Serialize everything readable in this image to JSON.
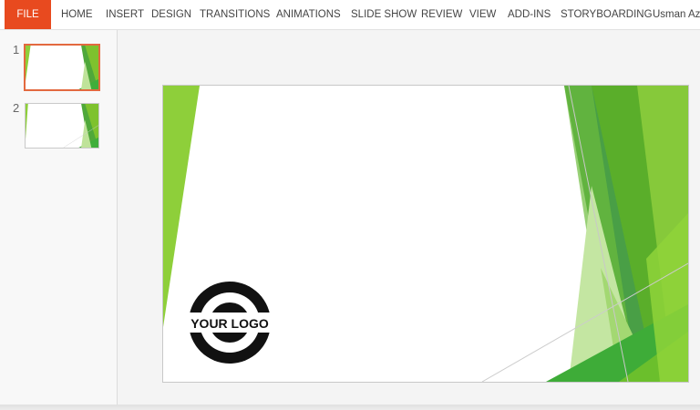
{
  "ribbon": {
    "tabs": [
      "FILE",
      "HOME",
      "INSERT",
      "DESIGN",
      "TRANSITIONS",
      "ANIMATIONS",
      "SLIDE SHOW",
      "REVIEW",
      "VIEW",
      "ADD-INS",
      "STORYBOARDING"
    ],
    "user": "Usman Aziz"
  },
  "thumbnails": [
    {
      "number": "1",
      "selected": true
    },
    {
      "number": "2",
      "selected": false
    }
  ],
  "slide": {
    "logo_text": "YOUR LOGO"
  },
  "colors": {
    "file_tab": "#e84a1f",
    "thumb_selected_border": "#e3693f",
    "green_light": "#8ecf3a",
    "green_mid": "#4fb23a",
    "green_dark": "#2f8a3a"
  }
}
